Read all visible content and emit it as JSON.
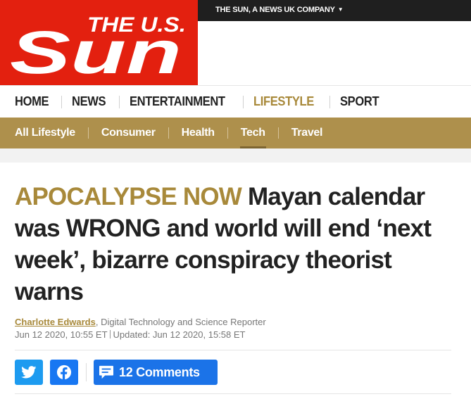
{
  "header": {
    "logo_text_small": "THE U.S.",
    "logo_text_large": "Sun",
    "topbar_link": "THE SUN, A NEWS UK COMPANY",
    "brand_color": "#e3200f"
  },
  "main_nav": {
    "items": [
      {
        "label": "HOME",
        "active": false
      },
      {
        "label": "NEWS",
        "active": false
      },
      {
        "label": "ENTERTAINMENT",
        "active": false
      },
      {
        "label": "LIFESTYLE",
        "active": true
      },
      {
        "label": "SPORT",
        "active": false
      }
    ],
    "active_color": "#a8893a"
  },
  "sub_nav": {
    "items": [
      {
        "label": "All Lifestyle",
        "active": false
      },
      {
        "label": "Consumer",
        "active": false
      },
      {
        "label": "Health",
        "active": false
      },
      {
        "label": "Tech",
        "active": true
      },
      {
        "label": "Travel",
        "active": false
      }
    ],
    "background": "#ae904c"
  },
  "article": {
    "kicker": "APOCALYPSE NOW",
    "headline": "Mayan calendar was WRONG and world will end ‘next week’, bizarre conspiracy theorist warns",
    "author": "Charlotte Edwards",
    "author_role": ", Digital Technology and Science Reporter",
    "published": "Jun 12 2020, 10:55 ET",
    "updated": "Updated: Jun 12 2020, 15:58 ET"
  },
  "share": {
    "twitter_icon": "twitter-icon",
    "facebook_icon": "facebook-icon",
    "comments_icon": "comment-bubble-icon",
    "comments_label": "12 Comments",
    "twitter_color": "#1d9bf0",
    "facebook_color": "#1877f2",
    "comments_color": "#1b73e8"
  }
}
